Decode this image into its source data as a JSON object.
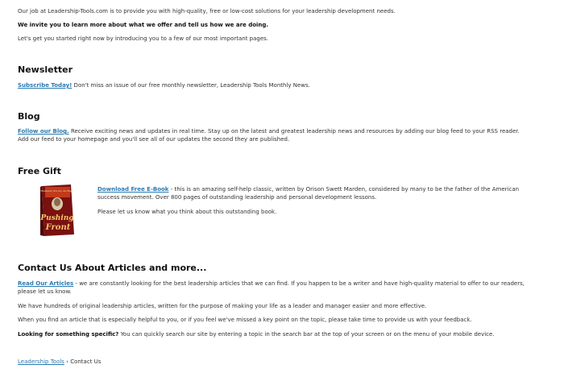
{
  "intro": {
    "line1": "Our job at Leadership-Tools.com is to provide you with high-quality, free or low-cost solutions for your leadership development needs.",
    "line2": "We invite you to learn more about what we offer and tell us how we are doing.",
    "line3": "Let's get you started right now by introducing you to a few of our most important pages."
  },
  "newsletter": {
    "heading": "Newsletter",
    "link": "Subscribe Today!",
    "text": " Don't miss an issue of our free monthly newsletter, Leadership Tools Monthly News."
  },
  "blog": {
    "heading": "Blog",
    "link": "Follow our Blog.",
    "text": "  Receive exciting news and updates in real time.  Stay up on the latest and greatest leadership news and resources by adding our blog feed to your RSS reader.  Add our feed to your homepage and you'll see all of our updates the second they are published."
  },
  "gift": {
    "heading": "Free Gift",
    "link": "Download Free E-Book",
    "text": " - this is an amazing self-help classic, written by Orison Swett Marden, considered by many to be the father of the American success movement. Over 800 pages of outstanding leadership and personal development lessons.",
    "note": "Please let us know what you think about this outstanding book.",
    "book_title_1": "Pushing",
    "book_title_2": "Front",
    "book_subtitle": "Whatever You Do, Do Right"
  },
  "contact": {
    "heading": "Contact Us About Articles and more...",
    "link": "Read Our Articles",
    "text": " - we are constantly looking for the best leadership articles that we can find. If you happen to be a writer and have high-quality material to offer to our readers, please let us know.",
    "para2": "We have hundreds of original leadership articles, written for the purpose of making your life as a leader and manager easier and more effective.",
    "para3": "When you find an article that is especially helpful to you, or if you feel we've missed a key point on the topic, please take time to provide us with your feedback.",
    "para4_bold": "Looking for something specific?",
    "para4_text": " You can quickly search our site by entering a topic in the search bar at the top of your screen or on the menu of your mobile device."
  },
  "breadcrumb": {
    "home": "Leadership Tools",
    "separator": " › ",
    "current": "Contact Us"
  }
}
